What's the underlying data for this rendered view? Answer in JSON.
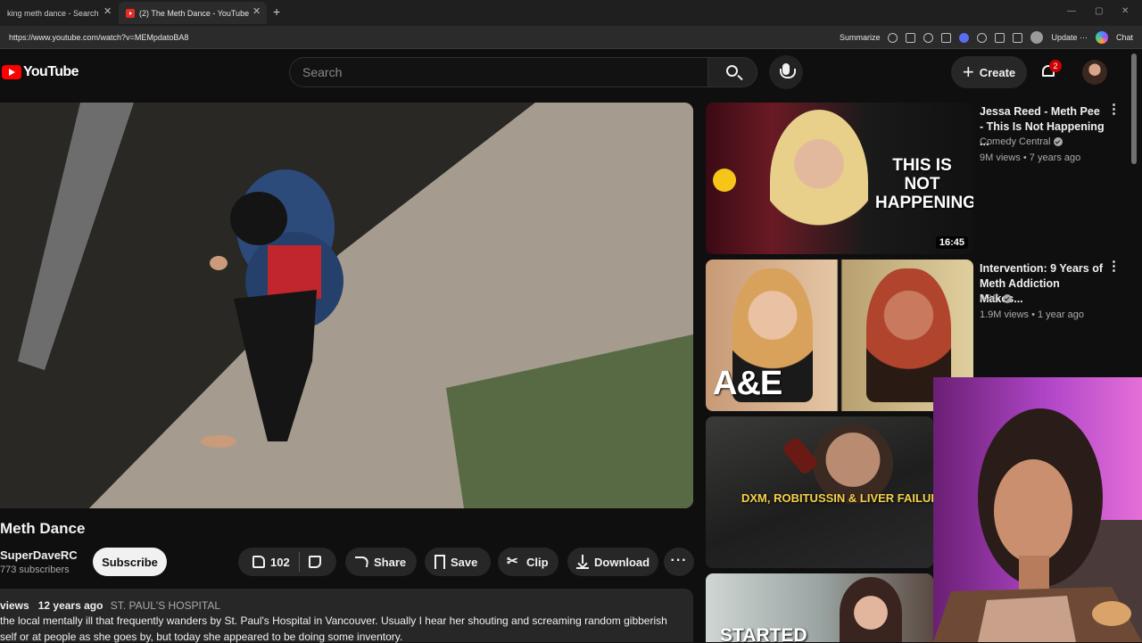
{
  "browser": {
    "tabs": [
      {
        "label": "king meth dance - Search"
      },
      {
        "label": "(2) The Meth Dance - YouTube"
      }
    ],
    "url": "https://www.youtube.com/watch?v=MEMpdatoBA8",
    "summarize_label": "Summarize",
    "update_label": "Update",
    "chat_label": "Chat"
  },
  "header": {
    "logo_text": "YouTube",
    "search_placeholder": "Search",
    "create_label": "Create",
    "notification_count": "2"
  },
  "video": {
    "title": "Meth Dance",
    "channel": "SuperDaveRC",
    "subscribers": "773 subscribers",
    "subscribe_label": "Subscribe",
    "likes": "102",
    "share_label": "Share",
    "save_label": "Save",
    "clip_label": "Clip",
    "download_label": "Download"
  },
  "description": {
    "views_label": "views",
    "age": "12 years ago",
    "tag": "ST. PAUL'S HOSPITAL",
    "lines": [
      "the local mentally ill that frequently wanders by St. Paul's Hospital in Vancouver. Usually I hear her shouting and screaming random gibberish",
      "self or at people as she goes by, but today she appeared to be doing some inventory."
    ]
  },
  "recommendations": [
    {
      "title": "Jessa Reed - Meth Pee - This Is Not Happening ...",
      "channel": "Comedy Central",
      "stats": "9M views • 7 years ago",
      "duration": "16:45",
      "thumb_text": "THIS IS NOT HAPPENING"
    },
    {
      "title": "Intervention: 9 Years of Meth Addiction Makes...",
      "channel": "A&E",
      "stats": "1.9M views • 1 year ago",
      "thumb_text": "A&E"
    },
    {
      "thumb_text": "DXM, ROBITUSSIN & LIVER FAILUR"
    },
    {
      "thumb_text": "STARTED"
    }
  ],
  "colors": {
    "background": "#0f0f0f",
    "accent_red": "#ff0000",
    "pill_bg": "#272727",
    "webcam_bg": "#b046c8"
  }
}
